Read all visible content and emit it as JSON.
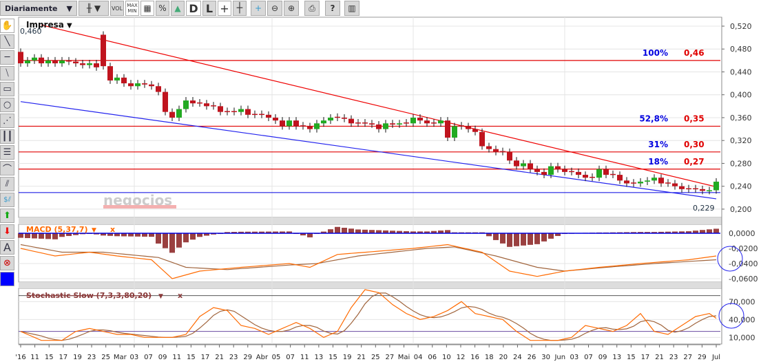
{
  "toolbar": {
    "period": "Diariamente",
    "buttons": [
      "candles-icon",
      "vol",
      "max-min",
      "grid-icon",
      "%",
      "area-icon",
      "D",
      "L",
      "crosshair-icon",
      "crosshair-l-icon",
      "add-indicator-icon",
      "zoom-out-icon",
      "zoom-in-icon",
      "print-icon",
      "?",
      "book-icon"
    ],
    "vol": "VOL",
    "maxmin_top": "MAX",
    "maxmin_bottom": "MIN",
    "pct": "%",
    "d": "D",
    "l": "L",
    "help": "?"
  },
  "left_tools": [
    "hand-icon",
    "line-icon",
    "horizontal-line-icon",
    "parallel-lines-icon",
    "rectangle-icon",
    "circle-icon",
    "fan-icon",
    "vertical-grid-icon",
    "horizontal-grid-icon",
    "arc-icon",
    "channel-icon",
    "dollar-channel-icon",
    "buy-arrow-icon",
    "sell-arrow-icon",
    "text-icon",
    "delete-icon",
    "color-picker-icon"
  ],
  "text_tool": "A",
  "price": {
    "title": "Impresa",
    "top_value": "0,460",
    "last_value": "0,229",
    "watermark": "negocios",
    "yticks": [
      "0,520",
      "0,480",
      "0,440",
      "0,400",
      "0,360",
      "0,320",
      "0,280",
      "0,240",
      "0,200"
    ],
    "fib": [
      {
        "pct": "100%",
        "val": "0,46",
        "price": 0.46
      },
      {
        "pct": "52,8%",
        "val": "0,35",
        "price": 0.345
      },
      {
        "pct": "31%",
        "val": "0,30",
        "price": 0.3
      },
      {
        "pct": "18%",
        "val": "0,27",
        "price": 0.27
      }
    ],
    "support": 0.229,
    "trend_red": [
      [
        3,
        0.522
      ],
      [
        101,
        0.239
      ]
    ],
    "trend_blue": [
      [
        0,
        0.388
      ],
      [
        101,
        0.218
      ]
    ],
    "closes": [
      0.455,
      0.46,
      0.465,
      0.455,
      0.46,
      0.455,
      0.46,
      0.458,
      0.455,
      0.452,
      0.455,
      0.448,
      0.45,
      0.425,
      0.43,
      0.42,
      0.415,
      0.42,
      0.418,
      0.415,
      0.405,
      0.37,
      0.36,
      0.375,
      0.39,
      0.385,
      0.385,
      0.38,
      0.38,
      0.37,
      0.37,
      0.37,
      0.375,
      0.365,
      0.365,
      0.365,
      0.36,
      0.355,
      0.345,
      0.355,
      0.345,
      0.345,
      0.34,
      0.35,
      0.355,
      0.36,
      0.36,
      0.358,
      0.35,
      0.35,
      0.35,
      0.348,
      0.34,
      0.35,
      0.348,
      0.35,
      0.35,
      0.36,
      0.355,
      0.35,
      0.35,
      0.355,
      0.325,
      0.345,
      0.345,
      0.34,
      0.335,
      0.31,
      0.305,
      0.3,
      0.3,
      0.285,
      0.275,
      0.28,
      0.27,
      0.265,
      0.26,
      0.275,
      0.27,
      0.265,
      0.265,
      0.26,
      0.255,
      0.255,
      0.27,
      0.26,
      0.26,
      0.25,
      0.245,
      0.245,
      0.248,
      0.25,
      0.255,
      0.245,
      0.245,
      0.24,
      0.235,
      0.235,
      0.235,
      0.232,
      0.233,
      0.248
    ],
    "first_open": 0.475,
    "spike_open_index": 12,
    "spike_open": 0.505
  },
  "macd": {
    "label": "MACD (5,37,7)",
    "close": "x",
    "yticks": [
      "0,0000",
      "-0,0200",
      "-0,0400",
      "-0,0600"
    ],
    "line": [
      [
        0,
        -0.02
      ],
      [
        5,
        -0.03
      ],
      [
        10,
        -0.025
      ],
      [
        14,
        -0.03
      ],
      [
        19,
        -0.035
      ],
      [
        22,
        -0.06
      ],
      [
        26,
        -0.05
      ],
      [
        32,
        -0.045
      ],
      [
        39,
        -0.04
      ],
      [
        42,
        -0.045
      ],
      [
        46,
        -0.028
      ],
      [
        57,
        -0.02
      ],
      [
        62,
        -0.015
      ],
      [
        67,
        -0.025
      ],
      [
        71,
        -0.05
      ],
      [
        75,
        -0.057
      ],
      [
        79,
        -0.05
      ],
      [
        84,
        -0.045
      ],
      [
        90,
        -0.04
      ],
      [
        97,
        -0.035
      ],
      [
        101,
        -0.03
      ]
    ],
    "signal": [
      [
        0,
        -0.015
      ],
      [
        6,
        -0.025
      ],
      [
        12,
        -0.025
      ],
      [
        20,
        -0.032
      ],
      [
        24,
        -0.045
      ],
      [
        30,
        -0.048
      ],
      [
        39,
        -0.042
      ],
      [
        43,
        -0.04
      ],
      [
        49,
        -0.03
      ],
      [
        59,
        -0.02
      ],
      [
        63,
        -0.018
      ],
      [
        69,
        -0.03
      ],
      [
        75,
        -0.045
      ],
      [
        79,
        -0.05
      ],
      [
        85,
        -0.045
      ],
      [
        92,
        -0.04
      ],
      [
        101,
        -0.035
      ]
    ]
  },
  "stoch": {
    "label": "Stochastic Slow (7,3,3,80,20)",
    "close": "x",
    "yticks": [
      "70,000",
      "40,000",
      "10,000"
    ],
    "upper": 80,
    "lower": 20,
    "k": [
      [
        0,
        20
      ],
      [
        3,
        5
      ],
      [
        6,
        5
      ],
      [
        8,
        20
      ],
      [
        10,
        25
      ],
      [
        14,
        15
      ],
      [
        16,
        15
      ],
      [
        18,
        10
      ],
      [
        22,
        10
      ],
      [
        24,
        15
      ],
      [
        26,
        45
      ],
      [
        28,
        60
      ],
      [
        30,
        55
      ],
      [
        32,
        30
      ],
      [
        34,
        25
      ],
      [
        36,
        15
      ],
      [
        38,
        25
      ],
      [
        40,
        35
      ],
      [
        42,
        25
      ],
      [
        44,
        10
      ],
      [
        46,
        20
      ],
      [
        48,
        60
      ],
      [
        50,
        90
      ],
      [
        52,
        85
      ],
      [
        54,
        65
      ],
      [
        56,
        50
      ],
      [
        58,
        40
      ],
      [
        60,
        45
      ],
      [
        62,
        55
      ],
      [
        64,
        70
      ],
      [
        66,
        50
      ],
      [
        68,
        45
      ],
      [
        70,
        40
      ],
      [
        72,
        20
      ],
      [
        74,
        5
      ],
      [
        78,
        5
      ],
      [
        80,
        10
      ],
      [
        82,
        30
      ],
      [
        84,
        25
      ],
      [
        86,
        20
      ],
      [
        88,
        30
      ],
      [
        90,
        50
      ],
      [
        92,
        20
      ],
      [
        94,
        15
      ],
      [
        96,
        30
      ],
      [
        98,
        45
      ],
      [
        100,
        50
      ],
      [
        101,
        42
      ]
    ]
  },
  "dates": [
    "'16",
    "11",
    "15",
    "17",
    "19",
    "23",
    "25",
    "Mar",
    "03",
    "07",
    "09",
    "11",
    "15",
    "17",
    "21",
    "23",
    "29",
    "Abr",
    "05",
    "07",
    "11",
    "13",
    "15",
    "19",
    "21",
    "25",
    "27",
    "Mai",
    "04",
    "06",
    "10",
    "12",
    "16",
    "18",
    "20",
    "24",
    "26",
    "30",
    "Jun",
    "03",
    "07",
    "09",
    "13",
    "15",
    "17",
    "21",
    "23",
    "27",
    "29",
    "Jul"
  ],
  "colors": {
    "up": "#22aa22",
    "down": "#c0141e",
    "fib": "#e00000",
    "blue": "#0000e0",
    "macd": "#ff6a00",
    "signal": "#a0643c",
    "hist": "#9a4040"
  }
}
